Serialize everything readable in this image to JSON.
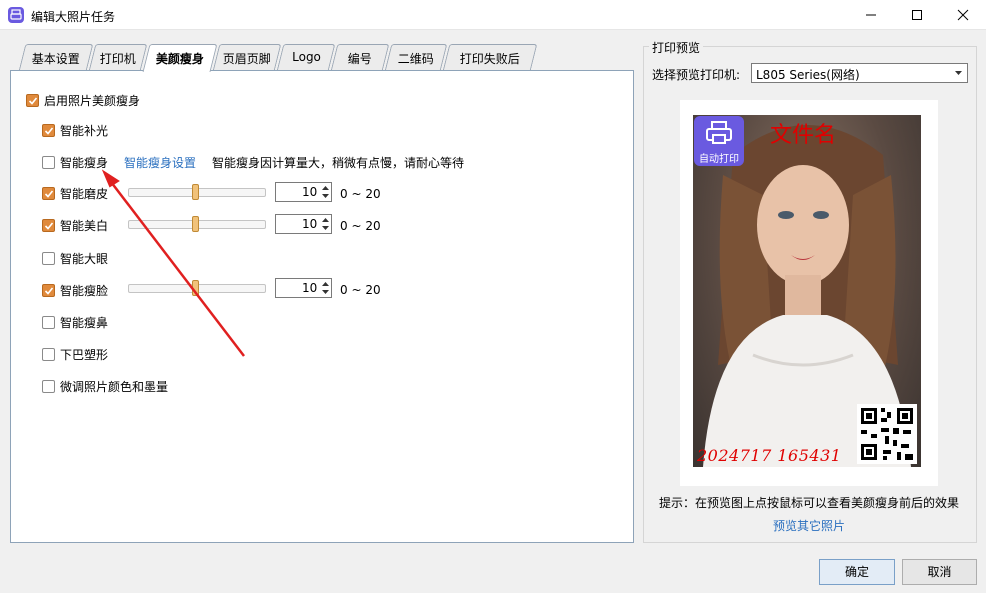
{
  "window": {
    "title": "编辑大照片任务"
  },
  "tabs": [
    {
      "label": "基本设置"
    },
    {
      "label": "打印机"
    },
    {
      "label": "美颜瘦身"
    },
    {
      "label": "页眉页脚"
    },
    {
      "label": "Logo"
    },
    {
      "label": "编号"
    },
    {
      "label": "二维码"
    },
    {
      "label": "打印失败后"
    }
  ],
  "active_tab": "美颜瘦身",
  "beauty": {
    "enable": {
      "label": "启用照片美颜瘦身",
      "checked": true
    },
    "options": [
      {
        "label": "智能补光",
        "checked": true
      },
      {
        "label": "智能瘦身",
        "checked": false,
        "link": "智能瘦身设置",
        "hint": "智能瘦身因计算量大，稍微有点慢，请耐心等待"
      },
      {
        "label": "智能磨皮",
        "checked": true,
        "value": "10",
        "range": "0 ~ 20",
        "level": 10,
        "max": 20
      },
      {
        "label": "智能美白",
        "checked": true,
        "value": "10",
        "range": "0 ~ 20",
        "level": 10,
        "max": 20
      },
      {
        "label": "智能大眼",
        "checked": false
      },
      {
        "label": "智能瘦脸",
        "checked": true,
        "value": "10",
        "range": "0 ~ 20",
        "level": 10,
        "max": 20
      },
      {
        "label": "智能瘦鼻",
        "checked": false
      },
      {
        "label": "下巴塑形",
        "checked": false
      },
      {
        "label": "微调照片颜色和墨量",
        "checked": false
      }
    ]
  },
  "preview": {
    "group_title": "打印预览",
    "printer_label": "选择预览打印机:",
    "printer_value": "L805 Series(网络)",
    "logo_text": "自动打印",
    "filename_overlay": "文件名",
    "stamp_overlay": "2024717  165431",
    "tip": "提示：在预览图上点按鼠标可以查看美颜瘦身前后的效果",
    "other_photos_link": "预览其它照片"
  },
  "buttons": {
    "ok": "确定",
    "cancel": "取消"
  },
  "colors": {
    "accent_checkbox": "#e08a3c",
    "link": "#2a6fbf",
    "overlay_red": "#e00000",
    "logo_purple": "#6a5ae0",
    "annotation_arrow": "#e02020"
  }
}
